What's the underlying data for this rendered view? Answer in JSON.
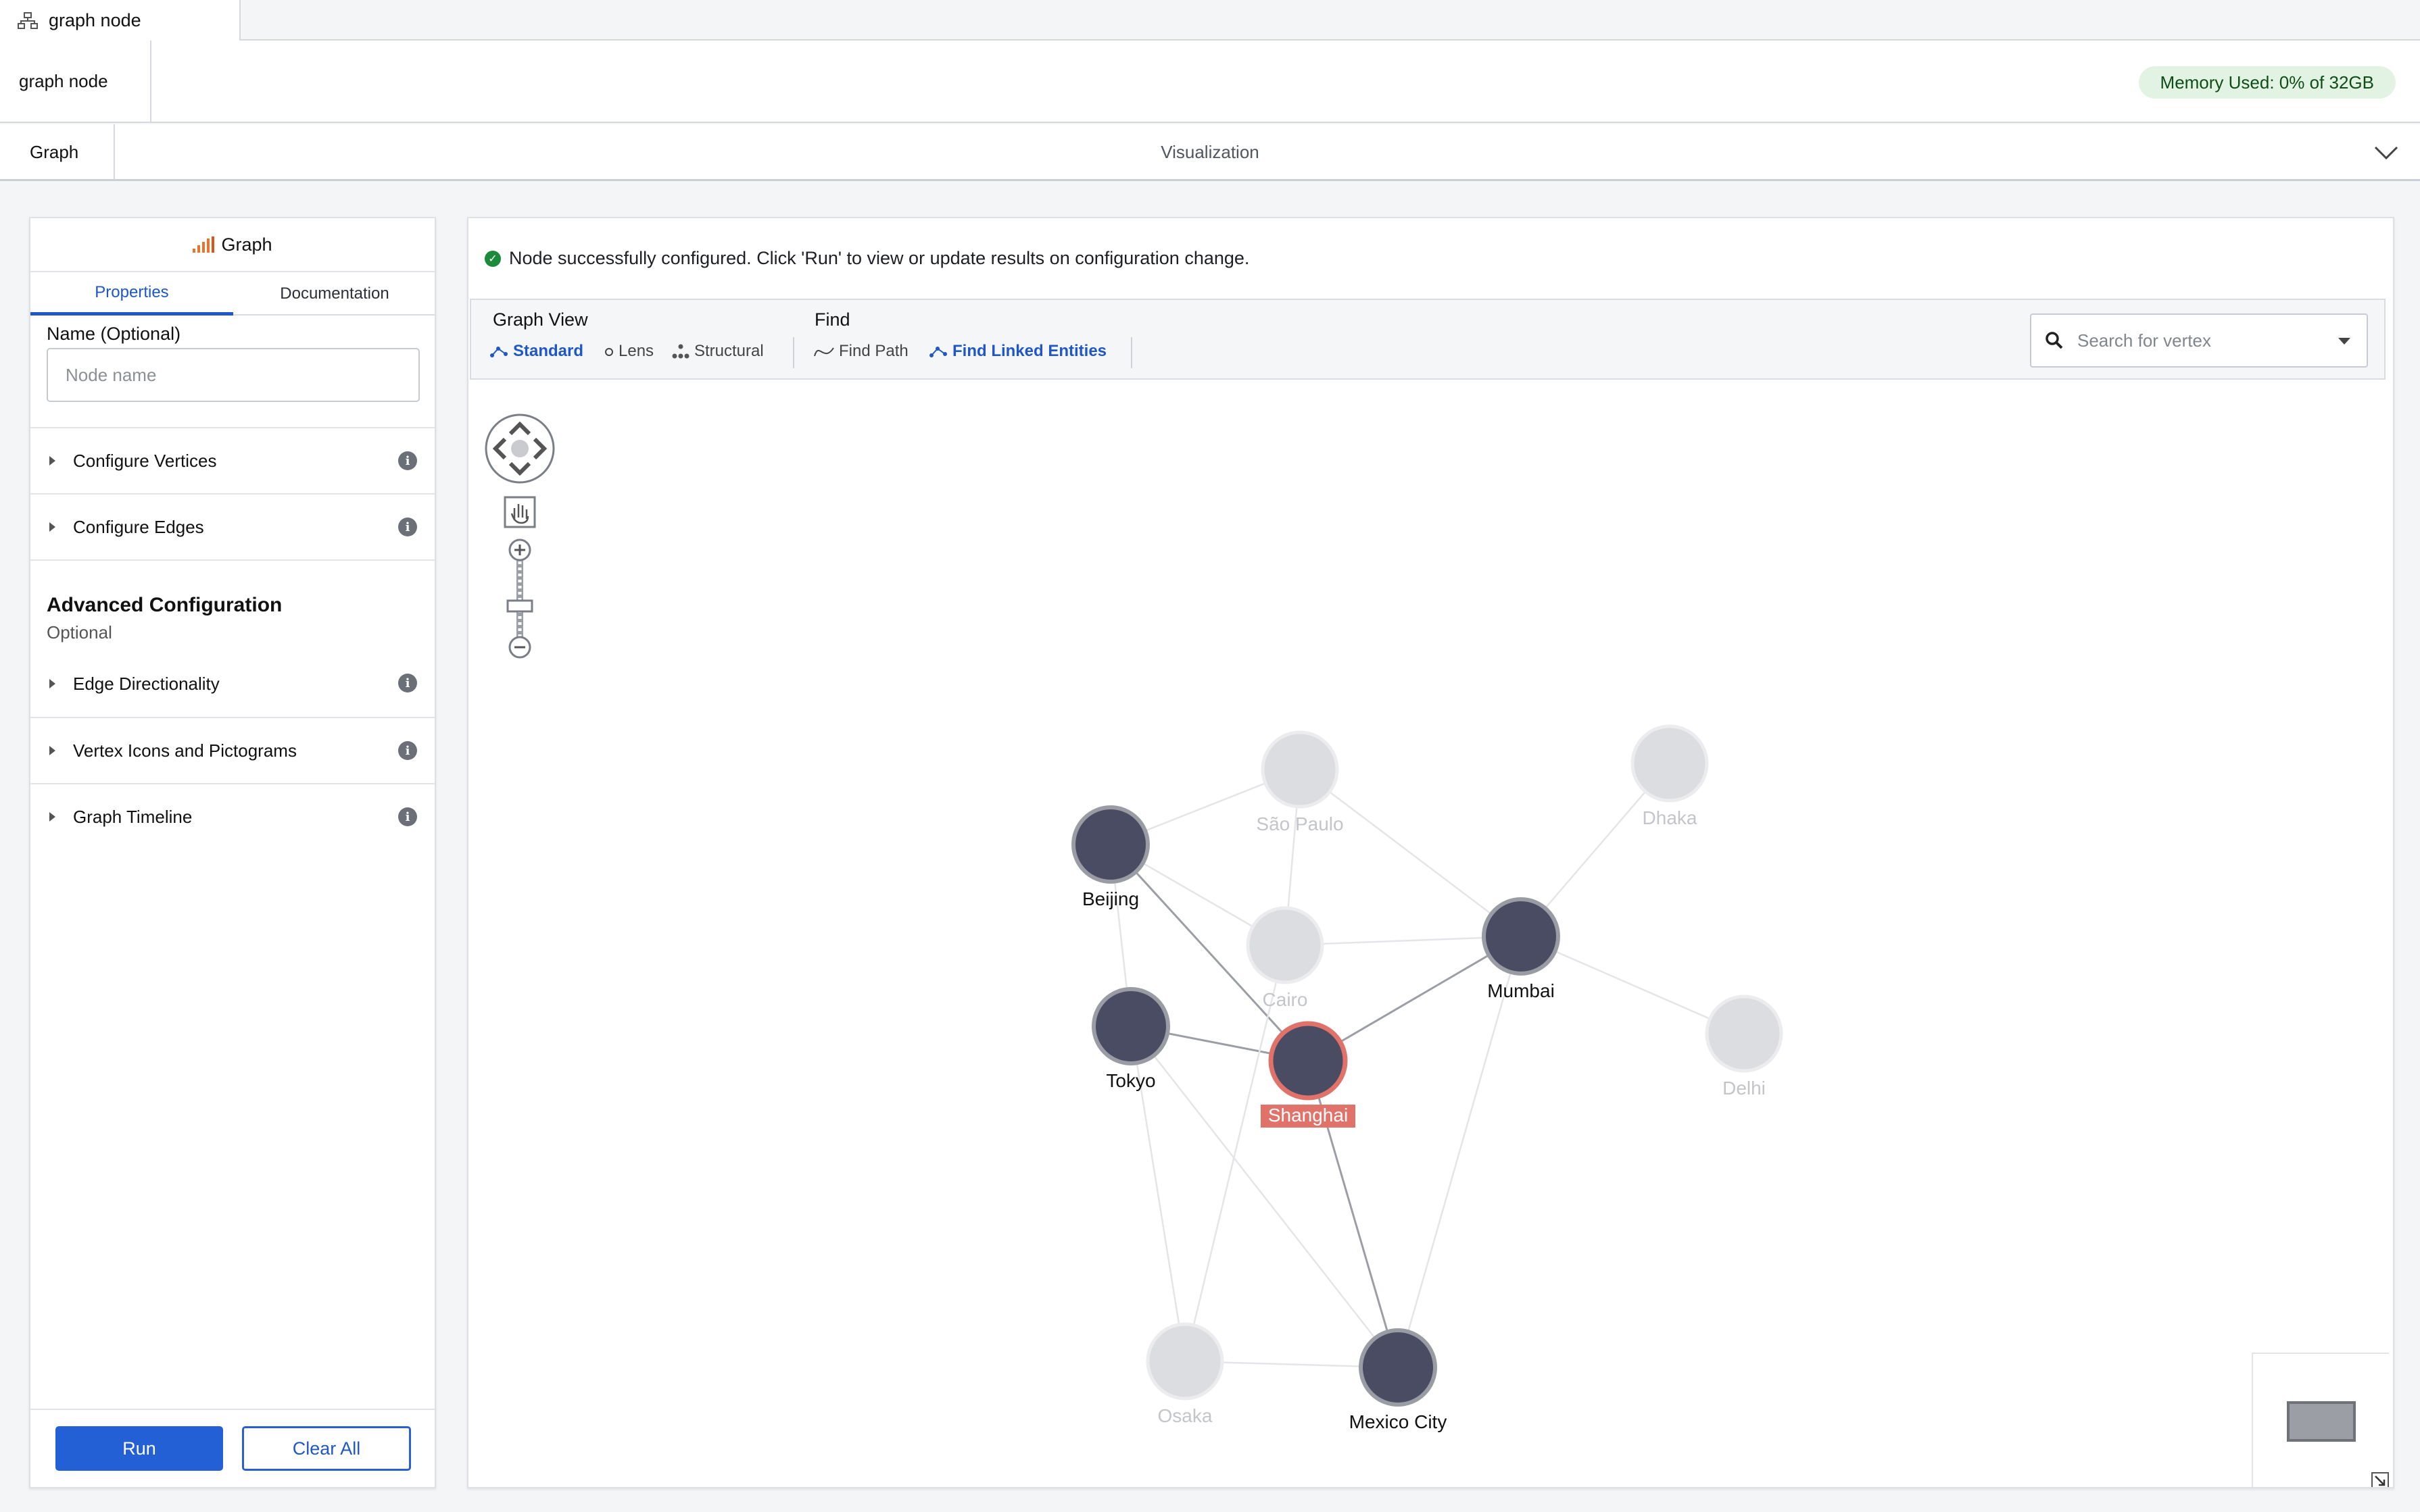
{
  "tab": {
    "title": "graph node",
    "icon": "graph-node-icon"
  },
  "node_header": {
    "name": "graph node",
    "memory_label": "Memory Used: 0% of 32GB"
  },
  "section_bar": {
    "graph_label": "Graph",
    "visualization_label": "Visualization"
  },
  "left_panel": {
    "title": "Graph",
    "tabs": [
      {
        "label": "Properties"
      },
      {
        "label": "Documentation"
      }
    ],
    "name_label": "Name (Optional)",
    "name_placeholder": "Node name",
    "accordions": [
      {
        "label": "Configure Vertices"
      },
      {
        "label": "Configure Edges"
      }
    ],
    "advanced": {
      "title": "Advanced Configuration",
      "subtitle": "Optional",
      "accordions": [
        {
          "label": "Edge Directionality"
        },
        {
          "label": "Vertex Icons and Pictograms"
        },
        {
          "label": "Graph Timeline"
        }
      ]
    },
    "run_label": "Run",
    "clear_label": "Clear All"
  },
  "right_panel": {
    "message": "Node successfully configured. Click 'Run' to view or update results on configuration change.",
    "toolbar": {
      "graph_view_title": "Graph View",
      "graph_view_items": [
        {
          "label": "Standard",
          "active": true
        },
        {
          "label": "Lens",
          "active": false
        },
        {
          "label": "Structural",
          "active": false
        }
      ],
      "find_title": "Find",
      "find_items": [
        {
          "label": "Find Path",
          "active": false
        },
        {
          "label": "Find Linked Entities",
          "active": true
        }
      ],
      "search_placeholder": "Search for vertex"
    }
  },
  "graph": {
    "colors": {
      "active_node": "#4a4c63",
      "inactive_node": "#dcdde0",
      "selected_ring": "#e0726a",
      "selected_label_bg": "#e0726a"
    },
    "nodes": [
      {
        "id": "beijing",
        "label": "Beijing",
        "state": "active"
      },
      {
        "id": "saopaulo",
        "label": "São Paulo",
        "state": "inactive"
      },
      {
        "id": "dhaka",
        "label": "Dhaka",
        "state": "inactive"
      },
      {
        "id": "cairo",
        "label": "Cairo",
        "state": "inactive"
      },
      {
        "id": "mumbai",
        "label": "Mumbai",
        "state": "active"
      },
      {
        "id": "delhi",
        "label": "Delhi",
        "state": "inactive"
      },
      {
        "id": "tokyo",
        "label": "Tokyo",
        "state": "active"
      },
      {
        "id": "shanghai",
        "label": "Shanghai",
        "state": "selected"
      },
      {
        "id": "osaka",
        "label": "Osaka",
        "state": "inactive"
      },
      {
        "id": "mexicocity",
        "label": "Mexico City",
        "state": "active"
      }
    ],
    "edges": [
      {
        "from": "beijing",
        "to": "shanghai",
        "strong": true
      },
      {
        "from": "tokyo",
        "to": "shanghai",
        "strong": true
      },
      {
        "from": "mumbai",
        "to": "shanghai",
        "strong": true
      },
      {
        "from": "shanghai",
        "to": "mexicocity",
        "strong": true
      },
      {
        "from": "beijing",
        "to": "saopaulo",
        "strong": false
      },
      {
        "from": "beijing",
        "to": "tokyo",
        "strong": false
      },
      {
        "from": "beijing",
        "to": "cairo",
        "strong": false
      },
      {
        "from": "saopaulo",
        "to": "cairo",
        "strong": false
      },
      {
        "from": "saopaulo",
        "to": "mumbai",
        "strong": false
      },
      {
        "from": "cairo",
        "to": "mumbai",
        "strong": false
      },
      {
        "from": "mumbai",
        "to": "dhaka",
        "strong": false
      },
      {
        "from": "mumbai",
        "to": "delhi",
        "strong": false
      },
      {
        "from": "mumbai",
        "to": "mexicocity",
        "strong": false
      },
      {
        "from": "cairo",
        "to": "osaka",
        "strong": false
      },
      {
        "from": "tokyo",
        "to": "mexicocity",
        "strong": false
      },
      {
        "from": "osaka",
        "to": "mexicocity",
        "strong": false
      },
      {
        "from": "tokyo",
        "to": "osaka",
        "strong": false
      }
    ]
  }
}
